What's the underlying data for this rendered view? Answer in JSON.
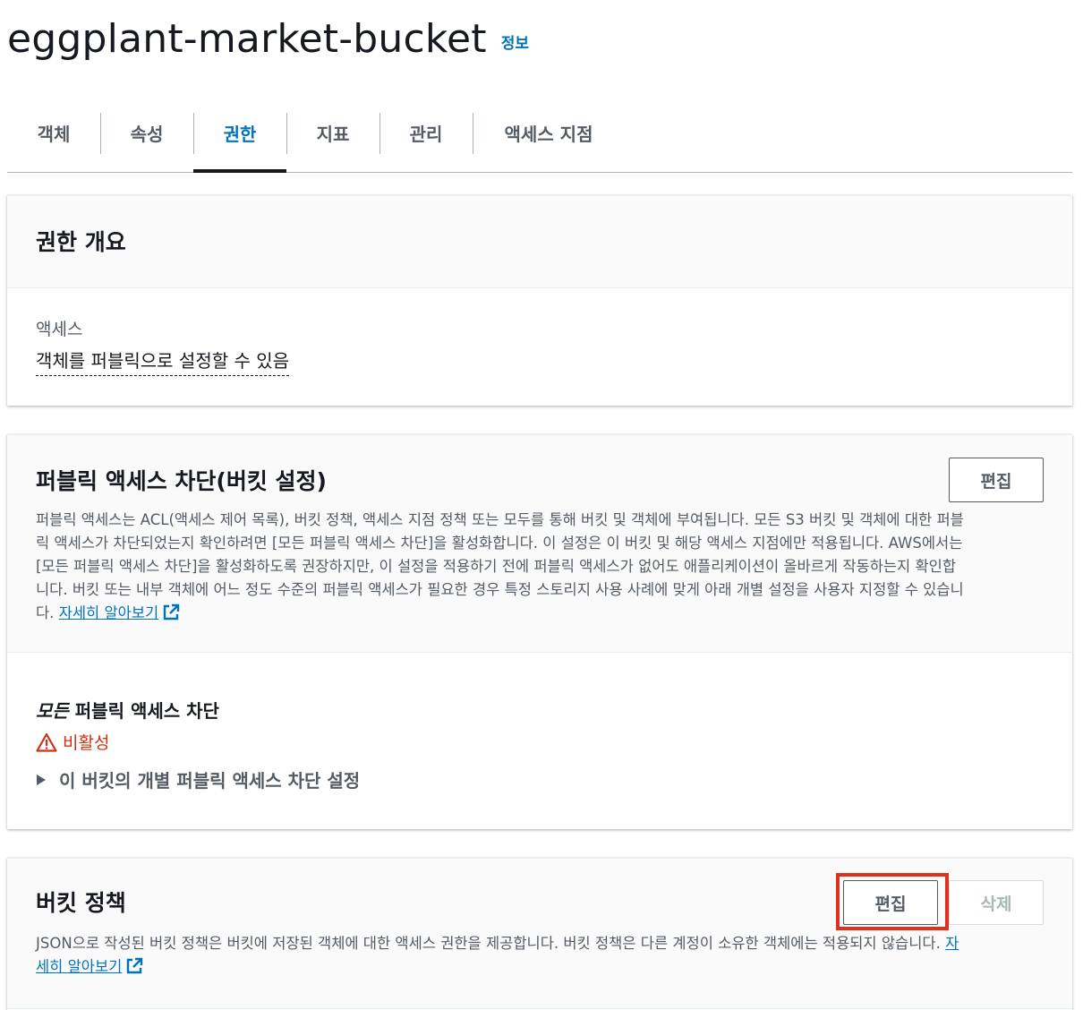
{
  "header": {
    "bucket_name": "eggplant-market-bucket",
    "info_label": "정보"
  },
  "tabs": [
    {
      "label": "객체",
      "active": false
    },
    {
      "label": "속성",
      "active": false
    },
    {
      "label": "권한",
      "active": true
    },
    {
      "label": "지표",
      "active": false
    },
    {
      "label": "관리",
      "active": false
    },
    {
      "label": "액세스 지점",
      "active": false
    }
  ],
  "permissions_overview": {
    "title": "권한 개요",
    "access_label": "액세스",
    "access_value": "객체를 퍼블릭으로 설정할 수 있음"
  },
  "block_public_access": {
    "title": "퍼블릭 액세스 차단(버킷 설정)",
    "edit_label": "편집",
    "description_lines": [
      "퍼블릭 액세스는 ACL(액세스 제어 목록), 버킷 정책, 액세스 지점 정책 또는 모두를 통해 버킷 및 객체에 부여됩니다. 모든 S3 버킷 및 객체에 대한 퍼블",
      "릭 액세스가 차단되었는지 확인하려면 [모든 퍼블릭 액세스 차단]을 활성화합니다. 이 설정은 이 버킷 및 해당 액세스 지점에만 적용됩니다. AWS에서는",
      "[모든 퍼블릭 액세스 차단]을 활성화하도록 권장하지만, 이 설정을 적용하기 전에 퍼블릭 액세스가 없어도 애플리케이션이 올바르게 작동하는지 확인합",
      "니다. 버킷 또는 내부 객체에 어느 정도 수준의 퍼블릭 액세스가 필요한 경우 특정 스토리지 사용 사례에 맞게 아래 개별 설정을 사용자 지정할 수 있습니",
      "다."
    ],
    "learn_more": "자세히 알아보기",
    "setting_title_italic": "모든",
    "setting_title_rest": " 퍼블릭 액세스 차단",
    "status": "비활성",
    "status_color": "#d13212",
    "expander_label": "이 버킷의 개별 퍼블릭 액세스 차단 설정"
  },
  "bucket_policy": {
    "title": "버킷 정책",
    "edit_label": "편집",
    "delete_label": "삭제",
    "description_line1": "JSON으로 작성된 버킷 정책은 버킷에 저장된 객체에 대한 액세스 권한을 제공합니다. 버킷 정책은 다른 계정이 소유한 객체에는 적용되지 않습니다.",
    "learn_more_part1": "자",
    "learn_more_part2": "세히 알아보기"
  },
  "colors": {
    "link": "#0073bb",
    "warning": "#d13212",
    "highlight_box": "#e0301e"
  }
}
